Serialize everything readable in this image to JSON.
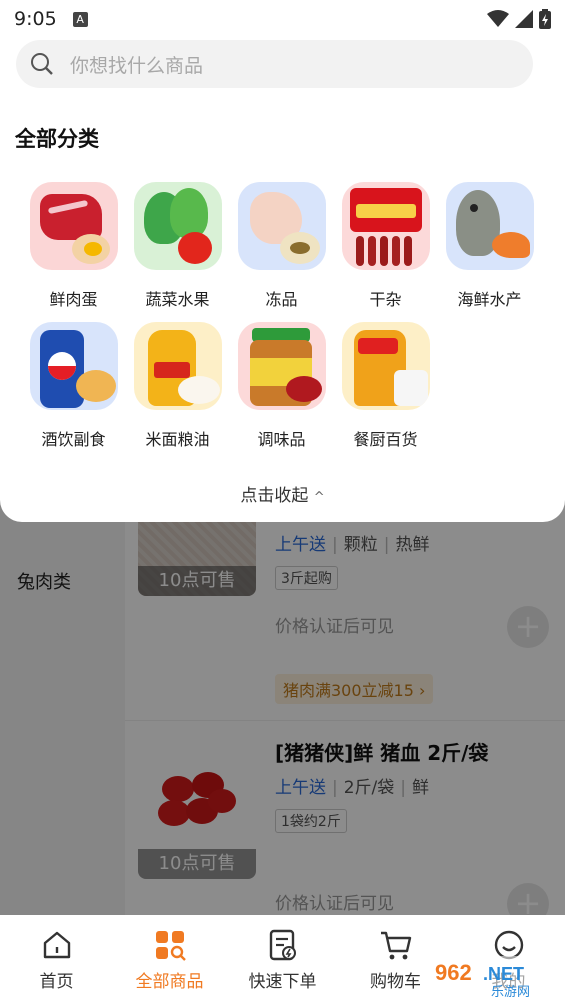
{
  "status": {
    "time": "9:05",
    "a_badge": "A"
  },
  "search": {
    "placeholder": "你想找什么商品"
  },
  "panel": {
    "title": "全部分类",
    "categories": [
      {
        "label": "鲜肉蛋",
        "icon": "meat-egg-icon"
      },
      {
        "label": "蔬菜水果",
        "icon": "vegetable-fruit-icon"
      },
      {
        "label": "冻品",
        "icon": "frozen-food-icon"
      },
      {
        "label": "干杂",
        "icon": "dry-goods-icon"
      },
      {
        "label": "海鲜水产",
        "icon": "seafood-icon"
      },
      {
        "label": "酒饮副食",
        "icon": "drinks-snacks-icon"
      },
      {
        "label": "米面粮油",
        "icon": "rice-oil-icon"
      },
      {
        "label": "调味品",
        "icon": "seasoning-icon"
      },
      {
        "label": "餐厨百货",
        "icon": "kitchen-goods-icon"
      }
    ],
    "collapse_label": "点击收起",
    "collapse_chevron": "^"
  },
  "background": {
    "sidebar_item": "兔肉类",
    "products": [
      {
        "title": "",
        "tag_delivery": "上午送",
        "tags": [
          "颗粒",
          "热鲜"
        ],
        "badge": "3斤起购",
        "price_note": "价格认证后可见",
        "sale_time": "10点可售",
        "promo": "猪肉满300立减15"
      },
      {
        "title": "[猪猪侠]鲜 猪血 2斤/袋",
        "tag_delivery": "上午送",
        "tags": [
          "2斤/袋",
          "鲜"
        ],
        "badge": "1袋约2斤",
        "price_note": "价格认证后可见",
        "sale_time": "10点可售"
      }
    ]
  },
  "tabbar": [
    {
      "label": "首页",
      "icon": "home-icon",
      "active": false
    },
    {
      "label": "全部商品",
      "icon": "all-products-icon",
      "active": true
    },
    {
      "label": "快速下单",
      "icon": "quick-order-icon",
      "active": false
    },
    {
      "label": "购物车",
      "icon": "cart-icon",
      "active": false
    },
    {
      "label": "我的",
      "icon": "profile-icon",
      "active": false
    }
  ],
  "watermark": "962.NET 乐游网",
  "colors": {
    "accent": "#f07a22",
    "blue_tag": "#2a6bd8"
  }
}
